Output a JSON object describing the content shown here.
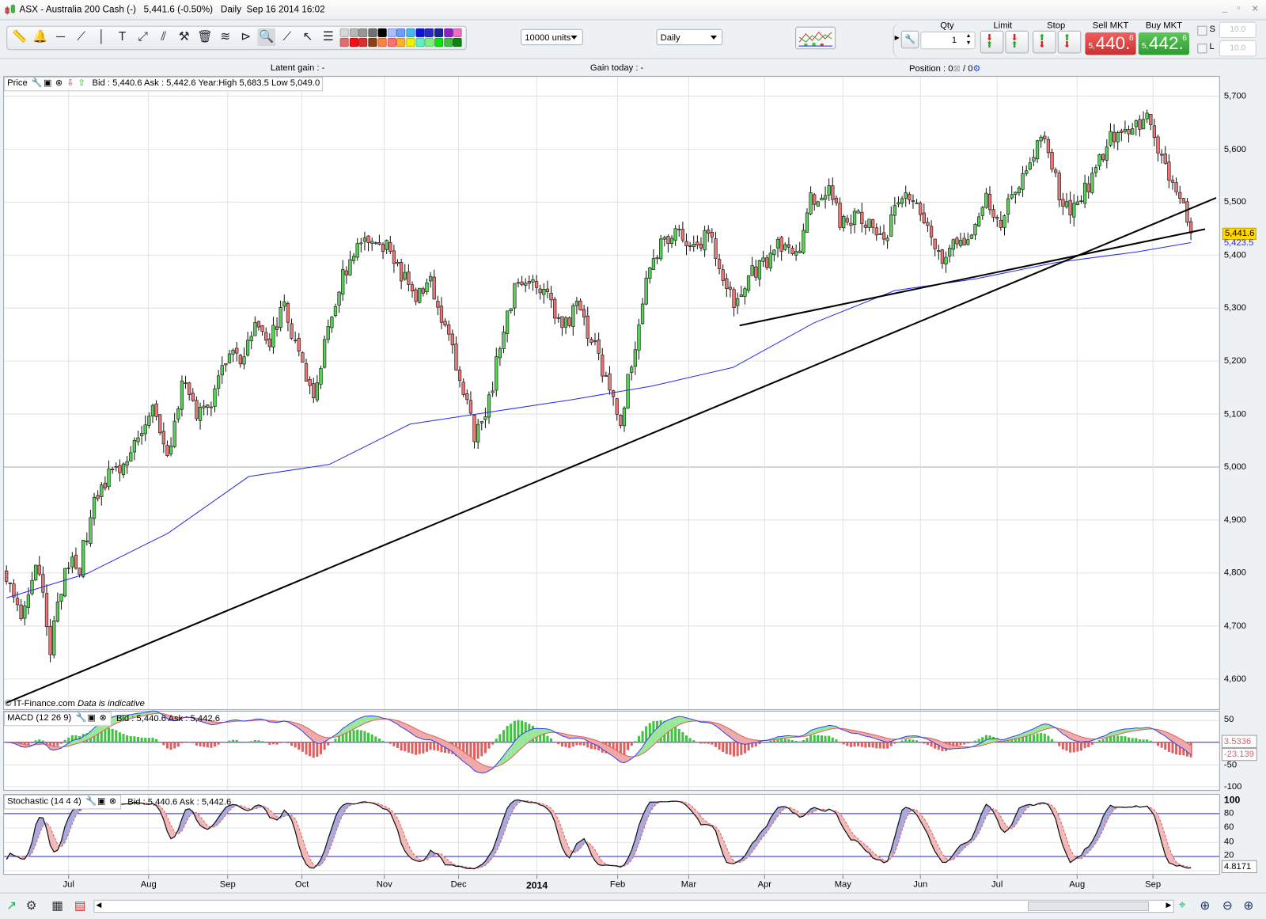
{
  "window": {
    "title": "ASX - Australia 200 Cash (-)",
    "last_price": "5,441.6 (-0.50%)",
    "period": "Daily",
    "datetime": "Sep 16 2014 16:02"
  },
  "toolbar": {
    "tools": [
      {
        "name": "ruler-icon",
        "glyph": "📏"
      },
      {
        "name": "alert-bell-icon",
        "glyph": "🔔"
      },
      {
        "name": "horizontal-line-icon",
        "glyph": "─"
      },
      {
        "name": "trend-line-icon",
        "glyph": "⟋"
      },
      {
        "name": "vertical-line-icon",
        "glyph": "│"
      },
      {
        "name": "text-tool-icon",
        "glyph": "T"
      },
      {
        "name": "extend-line-icon",
        "glyph": "⤢"
      },
      {
        "name": "parallel-channel-icon",
        "glyph": "⫽"
      },
      {
        "name": "tools-settings-icon",
        "glyph": "⚒"
      },
      {
        "name": "trash-icon",
        "glyph": "🗑"
      },
      {
        "name": "fibonacci-icon",
        "glyph": "≋"
      },
      {
        "name": "triangle-pattern-icon",
        "glyph": "⊳"
      },
      {
        "name": "zoom-magnifier-icon",
        "glyph": "🔍",
        "selected": true
      },
      {
        "name": "segment-line-icon",
        "glyph": "⟋"
      },
      {
        "name": "pointer-cursor-icon",
        "glyph": "↖"
      },
      {
        "name": "indicator-list-icon",
        "glyph": "☰"
      }
    ],
    "palette_top": [
      "#d8d8d8",
      "#b8b8b8",
      "#989898",
      "#707070",
      "#000000",
      "#a8c0ff",
      "#6f9cff",
      "#44b8f0",
      "#1010e0",
      "#2828c8",
      "#20209a",
      "#8a20c8",
      "#f070c0"
    ],
    "palette_bottom": [
      "#e07070",
      "#f01010",
      "#d83030",
      "#8a4010",
      "#ff8040",
      "#ff7070",
      "#ffb030",
      "#f0f000",
      "#60f0c0",
      "#80f080",
      "#10e010",
      "#40c040",
      "#108010"
    ],
    "units_select": "10000 units",
    "period_select": "Daily"
  },
  "order_panel": {
    "qty_label": "Qty",
    "qty_value": "1",
    "limit_label": "Limit",
    "stop_label": "Stop",
    "sell_label": "Sell MKT",
    "buy_label": "Buy MKT",
    "sell_price": {
      "prefix": "5,",
      "big": "440.",
      "pip": "6"
    },
    "buy_price": {
      "prefix": "5,",
      "big": "442.",
      "pip": "6"
    },
    "s_label": "S",
    "l_label": "L",
    "s_value": "10.0",
    "l_value": "10.0"
  },
  "info_bar": {
    "latent_gain": "Latent gain : -",
    "gain_today": "Gain today : -",
    "position": "Position : 0",
    "position_sep": " / 0"
  },
  "price_panel": {
    "legend_title": "Price",
    "legend_quote": "Bid : 5,440.6 Ask : 5,442.6 Year:High 5,683.5 Low 5,049.0",
    "copyright": "© IT-Finance.com",
    "disclaimer": "Data is indicative",
    "current_price_label": "5,441.6",
    "ma_value_label": "5,423.5",
    "y_ticks": [
      "5,700",
      "5,600",
      "5,500",
      "5,400",
      "5,300",
      "5,200",
      "5,100",
      "5,000",
      "4,900",
      "4,800",
      "4,700",
      "4,600"
    ]
  },
  "macd_panel": {
    "legend_title": "MACD (12 26 9)",
    "legend_quote": "Bid : 5,440.6 Ask : 5,442.6",
    "y_ticks": [
      "50",
      "-50",
      "-100"
    ],
    "macd_value": "3.5336",
    "signal_value": "-23.139"
  },
  "stoch_panel": {
    "legend_title": "Stochastic (14 4 4)",
    "legend_quote": "Bid : 5,440.6 Ask : 5,442.6",
    "y_ticks": [
      "100",
      "80",
      "60",
      "40",
      "20"
    ],
    "value": "4.8171"
  },
  "x_axis": {
    "labels": [
      "Jul",
      "Aug",
      "Sep",
      "Oct",
      "Nov",
      "Dec",
      "2014",
      "Feb",
      "Mar",
      "Apr",
      "May",
      "Jun",
      "Jul",
      "Aug",
      "Sep"
    ]
  },
  "chart_data": {
    "type": "candlestick",
    "instrument": "ASX - Australia 200 Cash",
    "interval": "Daily",
    "ylim": [
      4550,
      5740
    ],
    "closes_sampled_every_4_days": [
      4784,
      4723,
      4830,
      4662,
      4814,
      4814,
      4936,
      4982,
      5013,
      5058,
      5104,
      5013,
      5165,
      5089,
      5119,
      5195,
      5211,
      5256,
      5241,
      5302,
      5211,
      5134,
      5272,
      5363,
      5424,
      5424,
      5424,
      5363,
      5317,
      5348,
      5272,
      5165,
      5058,
      5119,
      5272,
      5348,
      5355,
      5332,
      5256,
      5302,
      5241,
      5172,
      5089,
      5226,
      5378,
      5424,
      5439,
      5409,
      5439,
      5363,
      5302,
      5363,
      5393,
      5424,
      5393,
      5500,
      5530,
      5470,
      5470,
      5470,
      5424,
      5516,
      5500,
      5439,
      5393,
      5439,
      5424,
      5516,
      5454,
      5530,
      5577,
      5622,
      5516,
      5485,
      5530,
      5592,
      5645,
      5630,
      5653,
      5577,
      5530,
      5441.6
    ],
    "moving_average_200": [
      4753,
      4799,
      4875,
      4982,
      5005,
      5081,
      5104,
      5127,
      5153,
      5188,
      5272,
      5333,
      5355,
      5386,
      5406,
      5423.5
    ],
    "trendlines": [
      {
        "from": {
          "day": 0,
          "price": 4555
        },
        "to": {
          "day": 330,
          "price": 5508
        }
      },
      {
        "from": {
          "day": 200,
          "price": 5267
        },
        "to": {
          "day": 327,
          "price": 5449
        }
      }
    ],
    "last": 5441.6,
    "year_high": 5683.5,
    "year_low": 5049.0,
    "colors": {
      "up": "#5ad05a",
      "down": "#e87878",
      "ma": "#2a2ae8",
      "trend": "#000000"
    }
  }
}
